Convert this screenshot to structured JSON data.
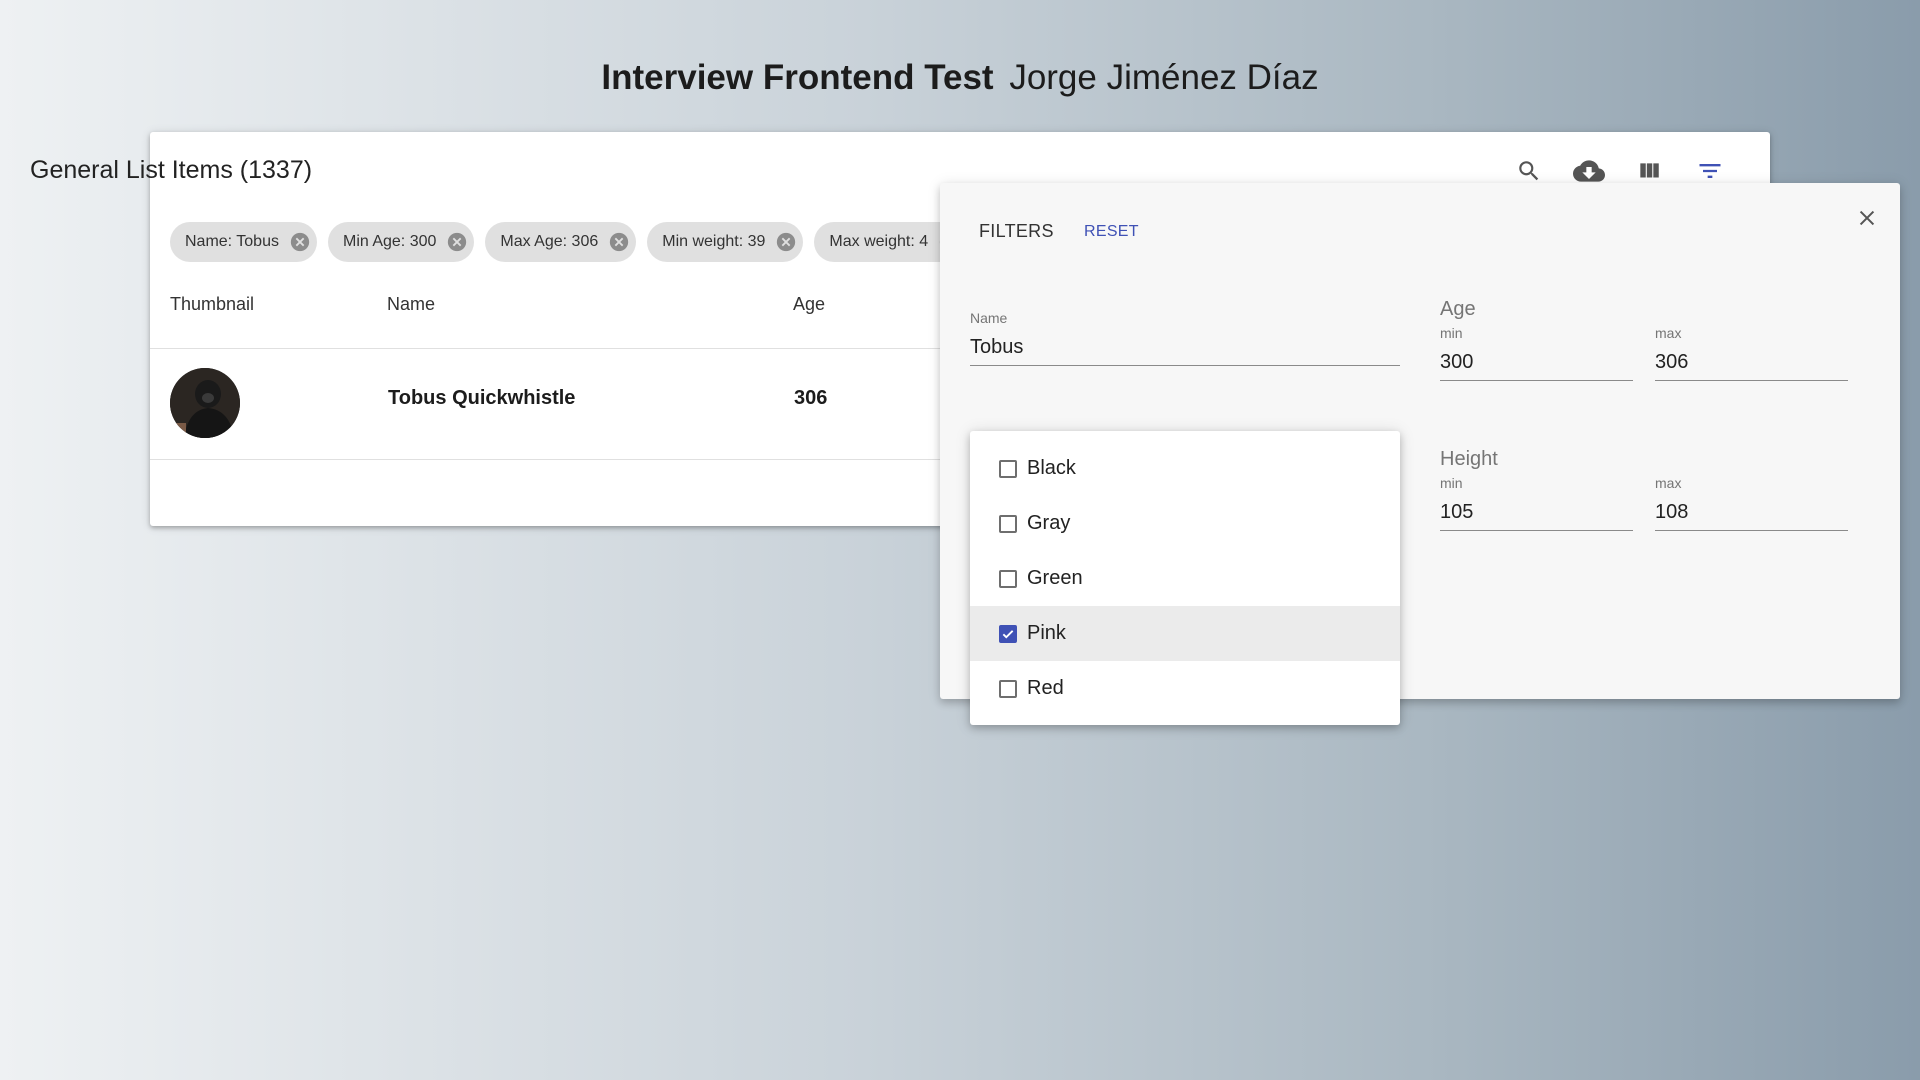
{
  "page": {
    "title_strong": "Interview Frontend Test",
    "title_author": "Jorge Jiménez Díaz"
  },
  "card": {
    "title": "General List Items (1337)",
    "toolbar": {
      "search_icon": "search-icon",
      "download_icon": "cloud-download-icon",
      "columns_icon": "view-column-icon",
      "filter_icon": "filter-list-icon"
    },
    "chips": [
      {
        "label": "Name: Tobus"
      },
      {
        "label": "Min Age: 300"
      },
      {
        "label": "Max Age: 306"
      },
      {
        "label": "Min weight: 39"
      },
      {
        "label": "Max weight: 4"
      }
    ],
    "columns": [
      "Thumbnail",
      "Name",
      "Age"
    ],
    "rows": [
      {
        "name": "Tobus Quickwhistle",
        "age": "306"
      }
    ]
  },
  "filters": {
    "heading": "FILTERS",
    "reset_label": "RESET",
    "name": {
      "label": "Name",
      "value": "Tobus"
    },
    "age": {
      "label": "Age",
      "min_label": "min",
      "min_value": "300",
      "max_label": "max",
      "max_value": "306"
    },
    "height": {
      "label": "Height",
      "min_label": "min",
      "min_value": "105",
      "max_label": "max",
      "max_value": "108"
    },
    "color_options": [
      {
        "label": "Black",
        "checked": false
      },
      {
        "label": "Gray",
        "checked": false
      },
      {
        "label": "Green",
        "checked": false
      },
      {
        "label": "Pink",
        "checked": true
      },
      {
        "label": "Red",
        "checked": false
      }
    ]
  },
  "colors": {
    "accent": "#3f51b5",
    "chip_bg": "#e0e0e0",
    "panel_bg": "#f7f7f7"
  }
}
